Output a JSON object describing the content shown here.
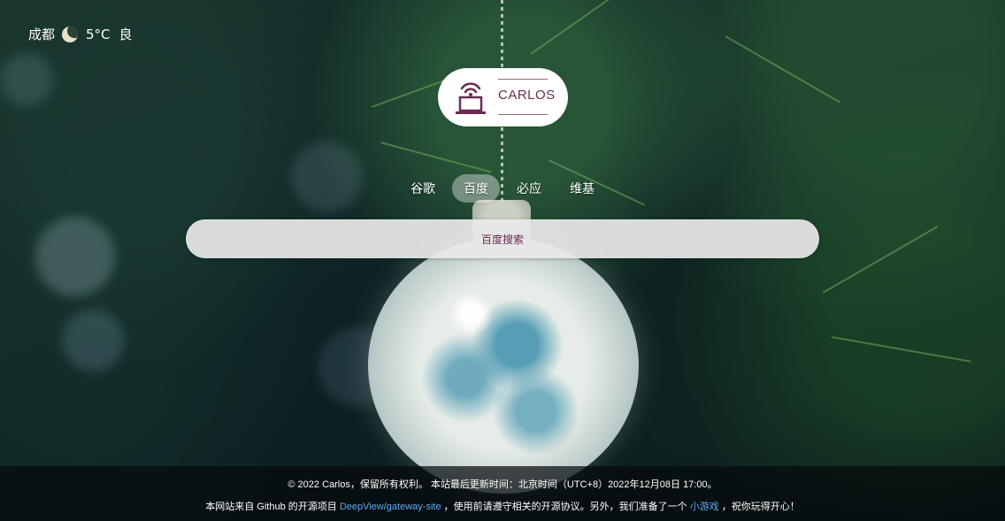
{
  "weather": {
    "city": "成都",
    "icon": "moon-icon",
    "temperature": "5°C",
    "air_quality": "良"
  },
  "logo": {
    "text": "CARLOS",
    "icon": "laptop-broadcast-icon",
    "color": "#6b2a55"
  },
  "engines": [
    {
      "label": "谷歌",
      "active": false
    },
    {
      "label": "百度",
      "active": true
    },
    {
      "label": "必应",
      "active": false
    },
    {
      "label": "维基",
      "active": false
    }
  ],
  "search": {
    "placeholder": "百度搜索"
  },
  "footer": {
    "line1": "© 2022 Carlos，保留所有权利。 本站最后更新时间：北京时间（UTC+8）2022年12月08日 17:00。",
    "line2_prefix": "本网站来自 Github 的开源项目 ",
    "repo_link": "DeepView/gateway-site",
    "line2_middle": " ，使用前请遵守相关的开源协议。另外，我们准备了一个 ",
    "game_link": "小游戏",
    "line2_suffix": " ，祝你玩得开心！",
    "link_color": "#5da9f0"
  }
}
